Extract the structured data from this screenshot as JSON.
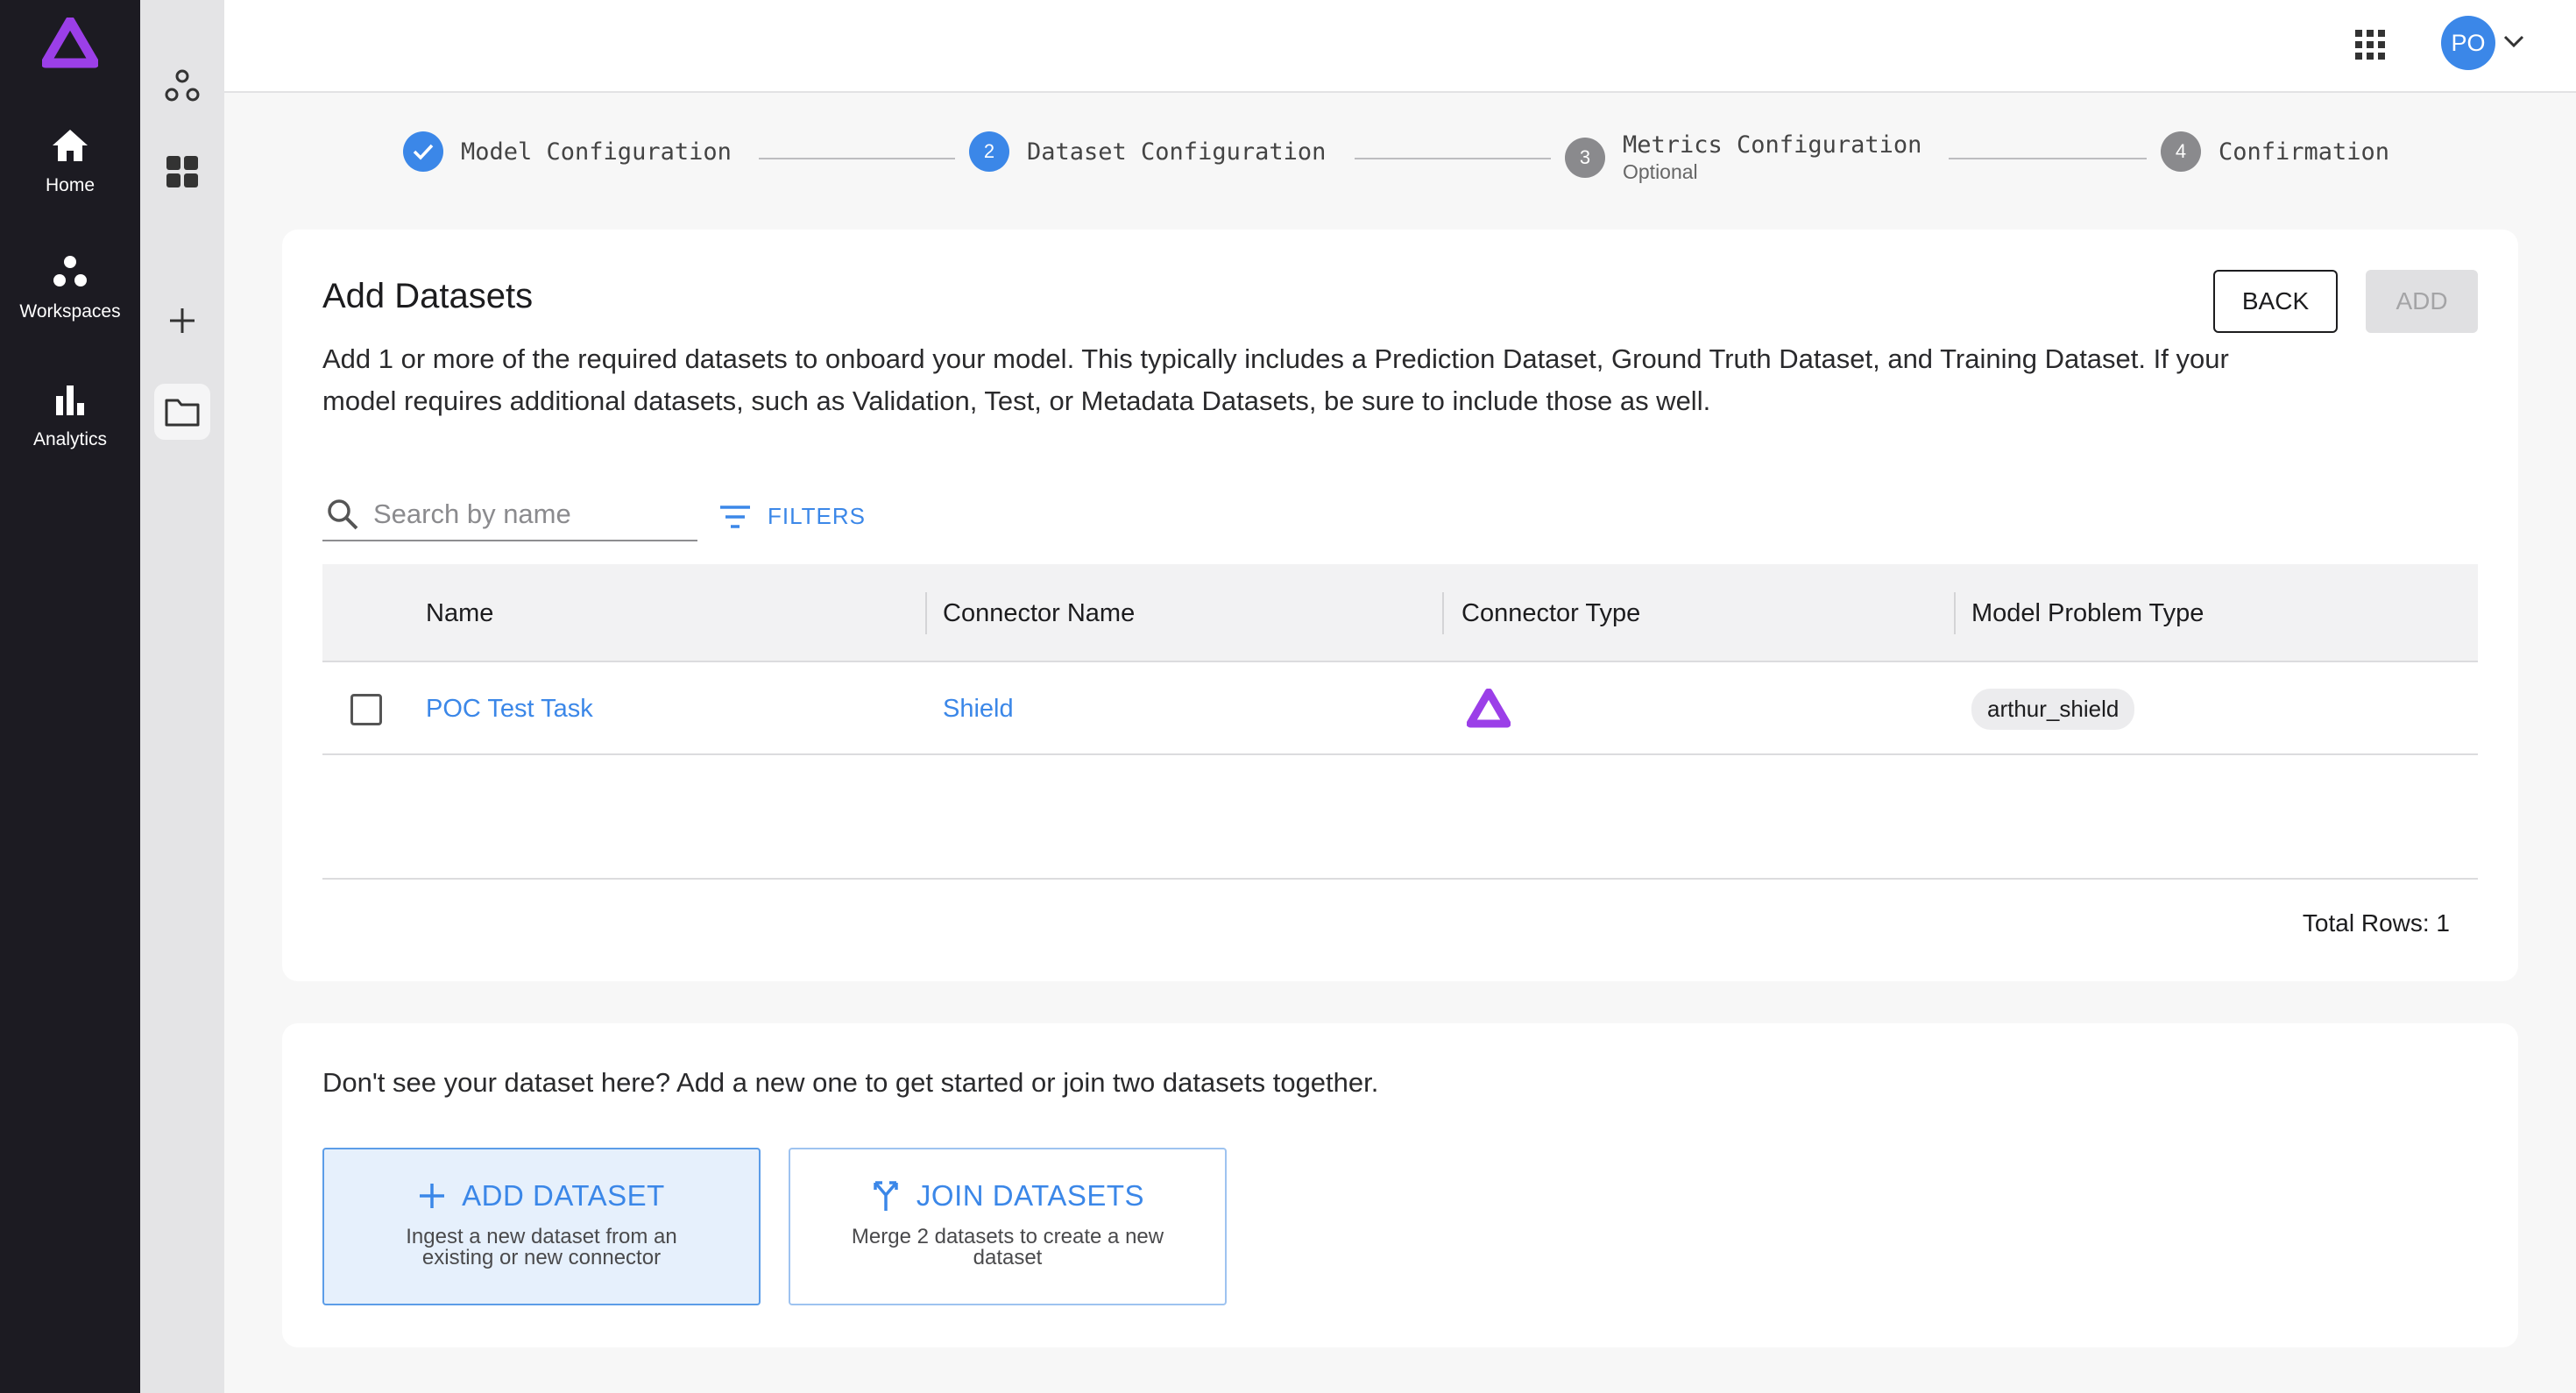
{
  "rail": {
    "items": [
      {
        "label": "Home",
        "icon": "home-icon"
      },
      {
        "label": "Workspaces",
        "icon": "workspaces-icon"
      },
      {
        "label": "Analytics",
        "icon": "analytics-icon"
      }
    ]
  },
  "user": {
    "initials": "PO"
  },
  "stepper": {
    "steps": [
      {
        "label": "Model Configuration",
        "state": "complete"
      },
      {
        "number": "2",
        "label": "Dataset Configuration",
        "state": "active"
      },
      {
        "number": "3",
        "label": "Metrics Configuration",
        "sublabel": "Optional",
        "state": "pending"
      },
      {
        "number": "4",
        "label": "Confirmation",
        "state": "pending"
      }
    ]
  },
  "datasets_card": {
    "title": "Add Datasets",
    "description": "Add 1 or more of the required datasets to onboard your model. This typically includes a Prediction Dataset, Ground Truth Dataset, and Training Dataset. If your model requires additional datasets, such as Validation, Test, or Metadata Datasets, be sure to include those as well.",
    "back_label": "BACK",
    "add_label": "ADD",
    "search": {
      "placeholder": "Search by name",
      "value": ""
    },
    "filters_label": "FILTERS",
    "table": {
      "columns": [
        "Name",
        "Connector Name",
        "Connector Type",
        "Model Problem Type"
      ],
      "rows": [
        {
          "name": "POC Test Task",
          "connector_name": "Shield",
          "connector_type_icon": "arthur-logo-icon",
          "model_problem_type": "arthur_shield",
          "checked": false
        }
      ]
    },
    "total_rows": "Total Rows: 1"
  },
  "new_dataset_card": {
    "prompt": "Don't see your dataset here? Add a new one to get started or join two datasets together.",
    "add_tile": {
      "label": "ADD DATASET",
      "sub": "Ingest a new dataset from an existing or new connector"
    },
    "join_tile": {
      "label": "JOIN DATASETS",
      "sub": "Merge 2 datasets to create a new dataset"
    }
  },
  "colors": {
    "accent": "#3b87e8",
    "brand_purple": "#9b3fe8",
    "rail_bg": "#1c1b22"
  }
}
